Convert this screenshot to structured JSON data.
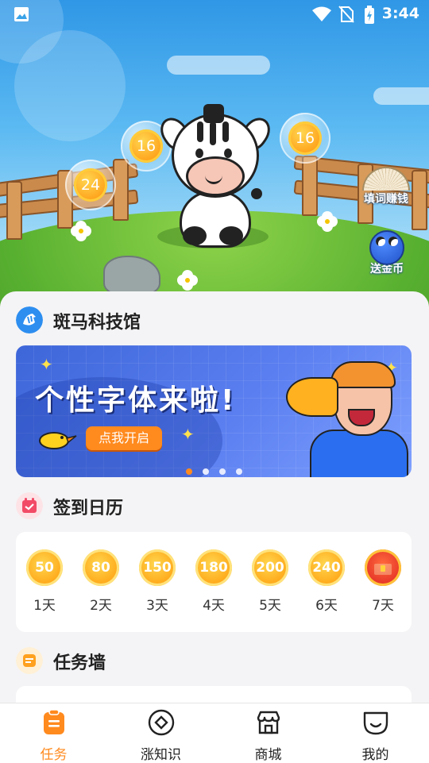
{
  "status_bar": {
    "time": "3:44"
  },
  "hero": {
    "coins": [
      "16",
      "24",
      "16"
    ],
    "side_buttons": {
      "fill_words": "填词赚钱",
      "send_coins": "送金币"
    }
  },
  "museum": {
    "title": "斑马科技馆"
  },
  "banner": {
    "headline": "个性字体来啦!",
    "cta": "点我开启",
    "slide_count": 4,
    "active_slide": 1
  },
  "signin": {
    "title": "签到日历",
    "days": [
      {
        "reward": "50",
        "label": "1天"
      },
      {
        "reward": "80",
        "label": "2天"
      },
      {
        "reward": "150",
        "label": "3天"
      },
      {
        "reward": "180",
        "label": "4天"
      },
      {
        "reward": "200",
        "label": "5天"
      },
      {
        "reward": "240",
        "label": "6天"
      },
      {
        "reward": "",
        "label": "7天",
        "icon": "treasure-chest-icon"
      }
    ]
  },
  "task_wall": {
    "title": "任务墙"
  },
  "tabbar": {
    "tabs": [
      {
        "label": "任务",
        "icon": "clipboard-icon",
        "active": true
      },
      {
        "label": "涨知识",
        "icon": "diamond-icon",
        "active": false
      },
      {
        "label": "商城",
        "icon": "store-icon",
        "active": false
      },
      {
        "label": "我的",
        "icon": "smile-icon",
        "active": false
      }
    ]
  },
  "colors": {
    "accent": "#ff8a1e",
    "sky": "#3fa6ea",
    "coin": "#ffab1c"
  }
}
